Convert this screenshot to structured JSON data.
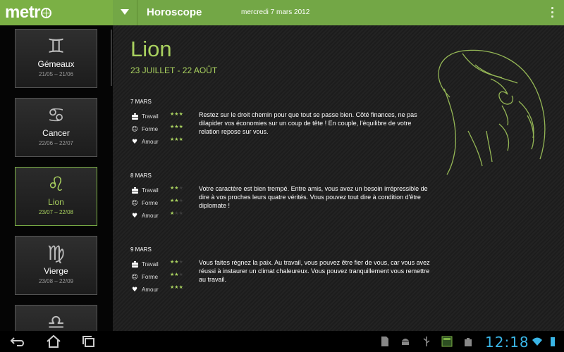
{
  "app": {
    "logo_text": "metr",
    "brand_color": "#7bb045"
  },
  "header": {
    "title": "Horoscope",
    "date": "mercredi 7 mars 2012"
  },
  "sidebar": {
    "signs": [
      {
        "symbol": "♊",
        "name": "Gémeaux",
        "range": "21/05 – 21/06",
        "active": false
      },
      {
        "symbol": "♋",
        "name": "Cancer",
        "range": "22/06 – 22/07",
        "active": false
      },
      {
        "symbol": "♌",
        "name": "Lion",
        "range": "23/07 – 22/08",
        "active": true
      },
      {
        "symbol": "♍",
        "name": "Vierge",
        "range": "23/08 – 22/09",
        "active": false
      },
      {
        "symbol": "♎",
        "name": "",
        "range": "",
        "active": false
      }
    ]
  },
  "main": {
    "title": "Lion",
    "subtitle": "23 JUILLET - 22 AOÛT",
    "days": [
      {
        "date": "7 MARS",
        "ratings": [
          {
            "icon": "briefcase-icon",
            "label": "Travail",
            "stars": 3
          },
          {
            "icon": "smiley-icon",
            "label": "Forme",
            "stars": 3
          },
          {
            "icon": "heart-icon",
            "label": "Amour",
            "stars": 3
          }
        ],
        "text": "Restez sur le droit chemin pour que tout se passe bien. Côté finances, ne pas dilapider vos économies sur un coup de tête ! En couple, l'équilibre de votre relation repose sur vous."
      },
      {
        "date": "8 MARS",
        "ratings": [
          {
            "icon": "briefcase-icon",
            "label": "Travail",
            "stars": 2
          },
          {
            "icon": "smiley-icon",
            "label": "Forme",
            "stars": 2
          },
          {
            "icon": "heart-icon",
            "label": "Amour",
            "stars": 1
          }
        ],
        "text": "Votre caractère est bien trempé. Entre amis, vous avez un besoin irrépressible de dire à vos proches leurs quatre vérités. Vous pouvez tout dire à condition d'être diplomate !"
      },
      {
        "date": "9 MARS",
        "ratings": [
          {
            "icon": "briefcase-icon",
            "label": "Travail",
            "stars": 2
          },
          {
            "icon": "smiley-icon",
            "label": "Forme",
            "stars": 2
          },
          {
            "icon": "heart-icon",
            "label": "Amour",
            "stars": 3
          }
        ],
        "text": "Vous faites régnez la paix. Au travail, vous pouvez être fier de vous, car vous avez réussi à instaurer un climat chaleureux. Vous pouvez tranquillement vous remettre au travail."
      }
    ]
  },
  "system_bar": {
    "clock": "12:18",
    "clock_color": "#3ab5e6"
  }
}
